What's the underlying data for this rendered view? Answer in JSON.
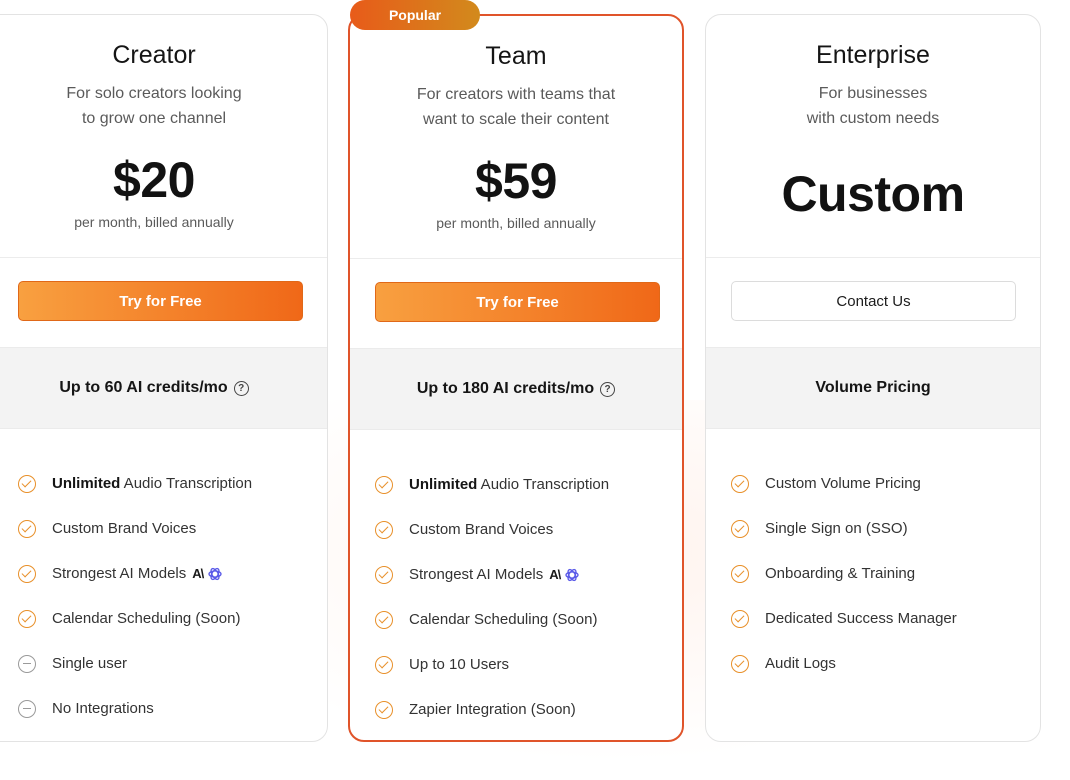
{
  "plans": [
    {
      "name": "Creator",
      "desc_line1": "For solo creators looking",
      "desc_line2": "to grow one channel",
      "price": "$20",
      "price_note": "per month, billed annually",
      "cta": "Try for Free",
      "credits": "Up to 60 AI credits/mo",
      "features": [
        {
          "bold": "Unlimited",
          "text": " Audio Transcription"
        },
        {
          "bold": "",
          "text": "Custom Brand Voices"
        },
        {
          "bold": "",
          "text": "Strongest AI Models"
        },
        {
          "bold": "",
          "text": "Calendar Scheduling (Soon)"
        },
        {
          "bold": "",
          "text": "Single user"
        },
        {
          "bold": "",
          "text": "No Integrations"
        }
      ]
    },
    {
      "name": "Team",
      "badge": "Popular",
      "desc_line1": "For creators with teams that",
      "desc_line2": "want to scale their content",
      "price": "$59",
      "price_note": "per month, billed annually",
      "cta": "Try for Free",
      "credits": "Up to 180 AI credits/mo",
      "features": [
        {
          "bold": "Unlimited",
          "text": " Audio Transcription"
        },
        {
          "bold": "",
          "text": "Custom Brand Voices"
        },
        {
          "bold": "",
          "text": "Strongest AI Models"
        },
        {
          "bold": "",
          "text": "Calendar Scheduling (Soon)"
        },
        {
          "bold": "",
          "text": "Up to 10 Users"
        },
        {
          "bold": "",
          "text": "Zapier Integration (Soon)"
        }
      ]
    },
    {
      "name": "Enterprise",
      "desc_line1": "For businesses",
      "desc_line2": "with custom needs",
      "price": "Custom",
      "cta": "Contact Us",
      "credits": "Volume Pricing",
      "features": [
        {
          "bold": "",
          "text": "Custom Volume Pricing"
        },
        {
          "bold": "",
          "text": "Single Sign on (SSO)"
        },
        {
          "bold": "",
          "text": "Onboarding & Training"
        },
        {
          "bold": "",
          "text": "Dedicated Success Manager"
        },
        {
          "bold": "",
          "text": "Audit Logs"
        }
      ]
    }
  ],
  "icons": {
    "check": "check-circle-icon",
    "minus": "minus-circle-icon",
    "help": "question-circle-icon",
    "anthropic": "anthropic-logo",
    "openai": "openai-logo"
  },
  "colors": {
    "accent": "#f06818",
    "popular_border": "#e0542a",
    "check": "#e8902a"
  }
}
